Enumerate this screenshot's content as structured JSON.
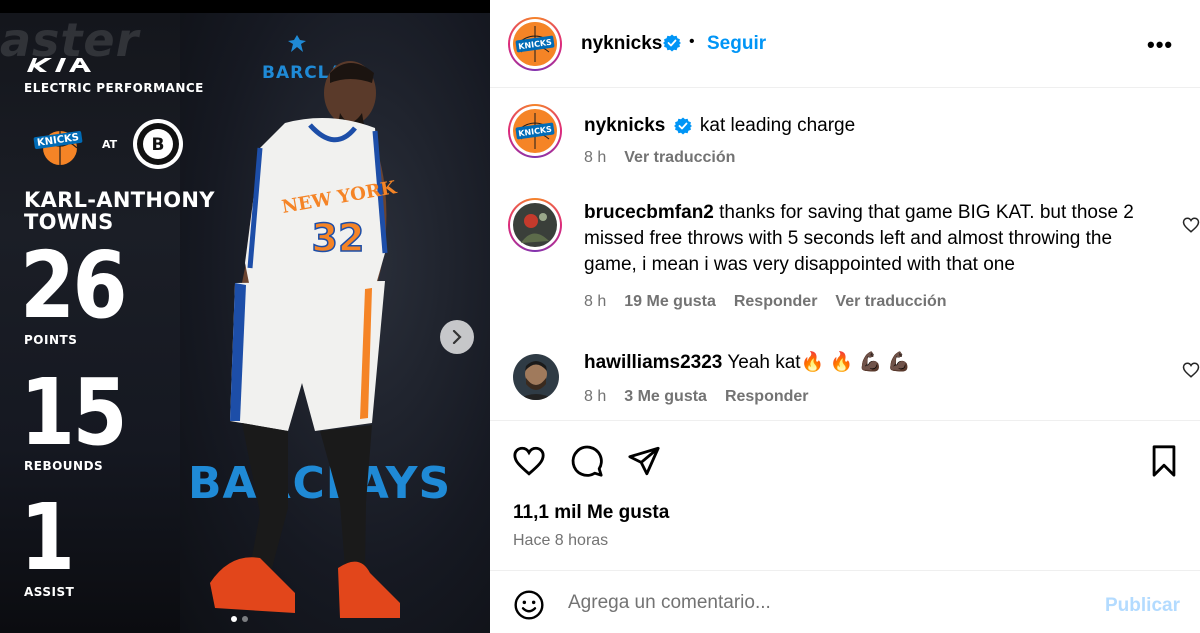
{
  "media": {
    "bg_text": "aster",
    "barclays_top": "BARCLAY",
    "barclays_bottom": "BARCLAYS",
    "kia_sub": "ELECTRIC PERFORMANCE",
    "at": "AT",
    "player_line1": "KARL-ANTHONY",
    "player_line2": "TOWNS",
    "stats": [
      {
        "value": "26",
        "label": "POINTS"
      },
      {
        "value": "15",
        "label": "REBOUNDS"
      },
      {
        "value": "1",
        "label": "ASSIST"
      }
    ],
    "slide_index": 1,
    "slide_count": 2
  },
  "header": {
    "username": "nyknicks",
    "separator": "•",
    "follow_label": "Seguir",
    "more_label": "•••"
  },
  "caption": {
    "username": "nyknicks",
    "text": "kat leading charge",
    "time": "8 h",
    "translate": "Ver traducción"
  },
  "comments": [
    {
      "username": "brucecbmfan2",
      "text": "thanks for saving that game BIG KAT. but those 2 missed free throws with 5 seconds left and almost throwing the game, i mean i was very disappointed with that one",
      "time": "8 h",
      "likes": "19 Me gusta",
      "reply": "Responder",
      "translate": "Ver traducción"
    },
    {
      "username": "hawilliams2323",
      "text": "Yeah kat🔥 🔥 💪🏿 💪🏿",
      "time": "8 h",
      "likes": "3 Me gusta",
      "reply": "Responder"
    }
  ],
  "actions": {
    "likes": "11,1 mil Me gusta",
    "time_ago": "Hace 8 horas"
  },
  "add_comment": {
    "placeholder": "Agrega un comentario...",
    "publish": "Publicar"
  },
  "colors": {
    "follow_blue": "#0095f6",
    "publish_disabled": "#b3dbff",
    "verified_blue": "#0095f6",
    "knicks_orange": "#f58426",
    "knicks_blue": "#006bb6"
  }
}
